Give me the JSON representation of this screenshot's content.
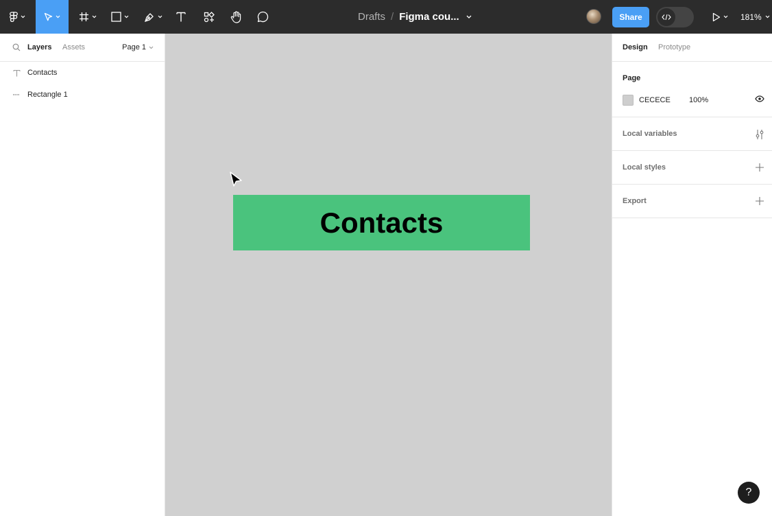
{
  "toolbar": {
    "tools": [
      {
        "name": "main-menu",
        "icon": "figma-logo-icon"
      },
      {
        "name": "move-tool",
        "icon": "move-pointer-icon",
        "active": true
      },
      {
        "name": "frame-tool",
        "icon": "frame-hash-icon"
      },
      {
        "name": "shape-tool",
        "icon": "rectangle-icon"
      },
      {
        "name": "pen-tool",
        "icon": "pen-icon"
      },
      {
        "name": "text-tool",
        "icon": "text-t-icon"
      },
      {
        "name": "resources-tool",
        "icon": "resources-icon"
      },
      {
        "name": "hand-tool",
        "icon": "hand-icon"
      },
      {
        "name": "comment-tool",
        "icon": "comment-bubble-icon"
      }
    ],
    "breadcrumb": {
      "folder": "Drafts",
      "separator": "/",
      "file": "Figma cou..."
    },
    "share_label": "Share",
    "zoom": "181%",
    "accent": "#4a9ff5"
  },
  "left_panel": {
    "tabs": {
      "layers": "Layers",
      "assets": "Assets"
    },
    "page_selector": "Page 1",
    "layers": [
      {
        "name": "Contacts",
        "icon": "text-layer-icon"
      },
      {
        "name": "Rectangle 1",
        "icon": "rectangle-layer-icon"
      }
    ]
  },
  "canvas": {
    "background": "#cecece",
    "rectangle_color": "#4ac37d",
    "text": "Contacts"
  },
  "right_panel": {
    "tabs": {
      "design": "Design",
      "prototype": "Prototype"
    },
    "page": {
      "title": "Page",
      "color_hex": "CECECE",
      "opacity": "100%"
    },
    "sections": [
      {
        "title": "Local variables",
        "icon": "variables-sliders-icon"
      },
      {
        "title": "Local styles",
        "icon": "plus-icon"
      },
      {
        "title": "Export",
        "icon": "plus-icon"
      }
    ]
  },
  "help_label": "?"
}
